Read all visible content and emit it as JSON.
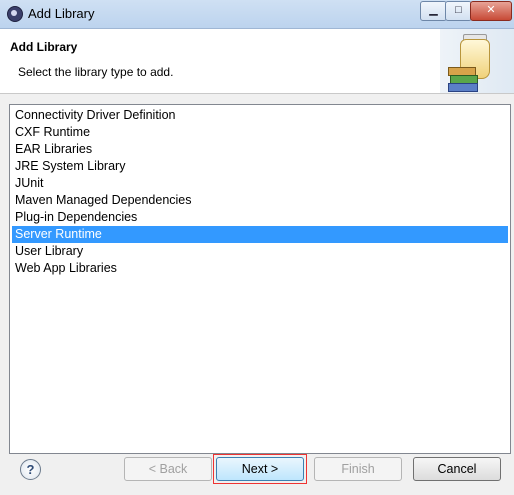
{
  "window": {
    "title": "Add Library",
    "controls": {
      "minimize": "▁",
      "maximize": "□",
      "close": "✕"
    }
  },
  "header": {
    "title": "Add Library",
    "description": "Select the library type to add.",
    "icon": "library-jar-books-icon"
  },
  "library_types": [
    "Connectivity Driver Definition",
    "CXF Runtime",
    "EAR Libraries",
    "JRE System Library",
    "JUnit",
    "Maven Managed Dependencies",
    "Plug-in Dependencies",
    "Server Runtime",
    "User Library",
    "Web App Libraries"
  ],
  "selected_index": 7,
  "buttons": {
    "help": "?",
    "back": "< Back",
    "next": "Next >",
    "finish": "Finish",
    "cancel": "Cancel"
  },
  "colors": {
    "selection": "#3399ff",
    "focus_outline": "#ee3333"
  }
}
